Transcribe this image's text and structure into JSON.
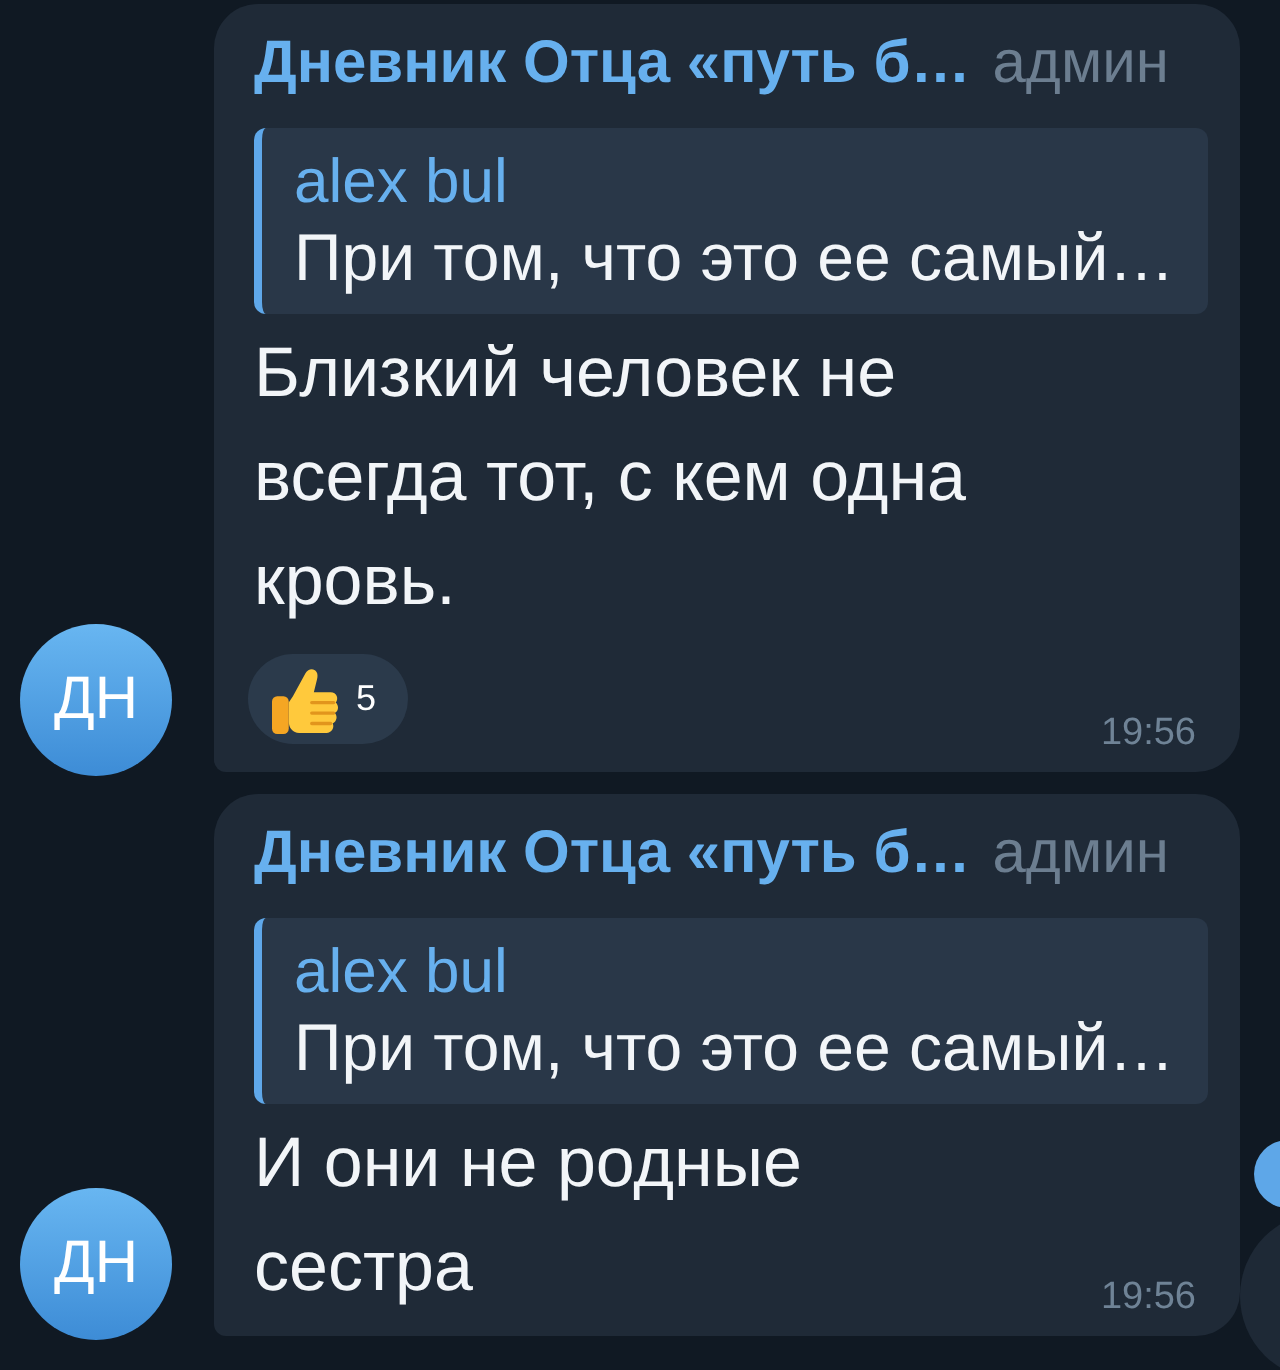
{
  "messages": [
    {
      "avatar": {
        "initials": "ДН"
      },
      "sender": {
        "name": "Дневник Отца «путь б…",
        "role": "админ"
      },
      "reply": {
        "author": "alex bul",
        "text": "При том, что это ее самый…"
      },
      "text": "Близкий человек не всегда тот, с кем одна кровь.",
      "reactions": [
        {
          "count": "5",
          "selected": false
        }
      ],
      "time": "19:56"
    },
    {
      "avatar": {
        "initials": "ДН"
      },
      "sender": {
        "name": "Дневник Отца «путь б…",
        "role": "админ"
      },
      "reply": {
        "author": "alex bul",
        "text": "При том, что это ее самый…"
      },
      "text": "И они не родные сестра",
      "time": "19:56"
    }
  ]
}
